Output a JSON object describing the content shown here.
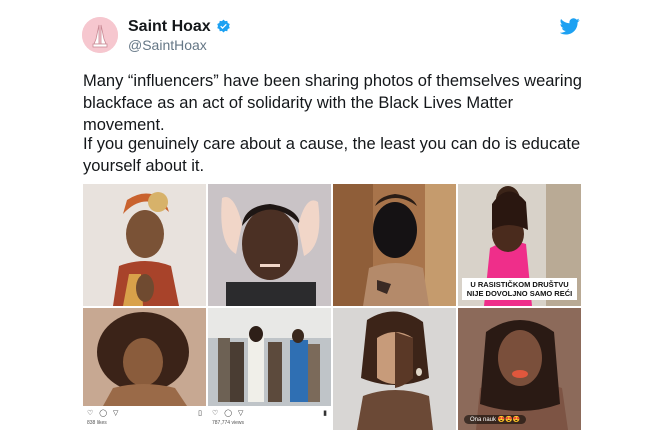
{
  "author": {
    "name": "Saint Hoax",
    "handle": "@SaintHoax"
  },
  "tweet": {
    "paragraph1": "Many “influencers” have been sharing photos of themselves wearing blackface as an act of solidarity with the Black Lives Matter movement.",
    "paragraph2": "If you genuinely care about a cause, the least you can do is educate yourself about it."
  },
  "media": {
    "caption_photo4": "U RASISTIČKOM DRUŠTVU NIJE DOVOLJNO SAMO REĆI",
    "likes_photo5": "838 likes",
    "likes_photo6": "787,774 views",
    "pill_photo8": "Ona nauk 😍😍😍"
  },
  "icons": {
    "verified": "verified-badge-icon",
    "twitter": "twitter-bird-icon"
  },
  "colors": {
    "brand_blue": "#1da1f2",
    "text": "#14171a",
    "secondary": "#657786"
  }
}
